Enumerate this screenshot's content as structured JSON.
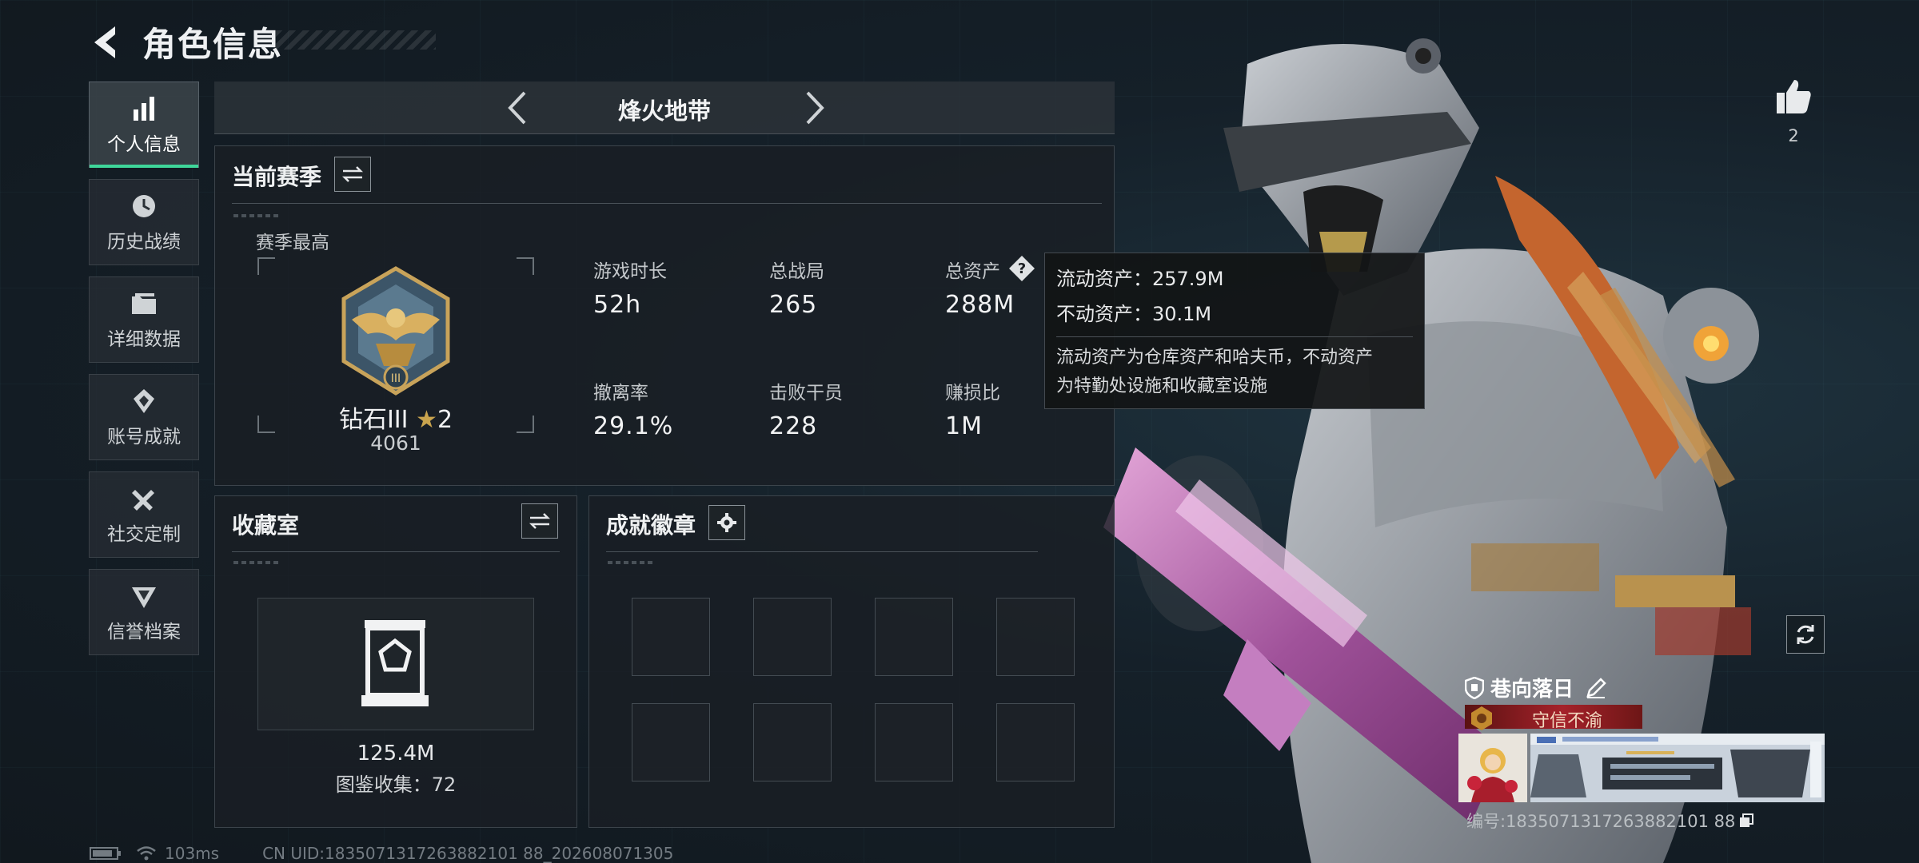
{
  "header": {
    "title": "角色信息"
  },
  "nav": {
    "items": [
      {
        "label": "个人信息",
        "icon": "bar-chart-icon",
        "active": true
      },
      {
        "label": "历史战绩",
        "icon": "clock-history-icon"
      },
      {
        "label": "详细数据",
        "icon": "folder-icon"
      },
      {
        "label": "账号成就",
        "icon": "achievement-badge-icon"
      },
      {
        "label": "社交定制",
        "icon": "tools-icon"
      },
      {
        "label": "信誉档案",
        "icon": "reputation-icon"
      }
    ]
  },
  "mode": {
    "title": "烽火地带"
  },
  "season": {
    "title": "当前赛季",
    "best_label": "赛季最高",
    "rank_name": "钻石III",
    "rank_stars": "2",
    "rank_score": "4061",
    "stats": [
      {
        "label": "游戏时长",
        "value": "52h"
      },
      {
        "label": "总战局",
        "value": "265"
      },
      {
        "label": "总资产",
        "value": "288M"
      },
      {
        "label": "撤离率",
        "value": "29.1%"
      },
      {
        "label": "击败干员",
        "value": "228"
      },
      {
        "label": "赚损比",
        "value": "1M"
      }
    ]
  },
  "tooltip": {
    "liquid": "流动资产：257.9M",
    "fixed": "不动资产：30.1M",
    "desc_line1": "流动资产为仓库资产和哈夫币，不动资产",
    "desc_line2": "为特勤处设施和收藏室设施"
  },
  "collection": {
    "title": "收藏室",
    "value": "125.4M",
    "count": "图鉴收集：72"
  },
  "badges": {
    "title": "成就徽章",
    "slot_count": 8
  },
  "status": {
    "ping": "103ms",
    "uid": "CN UID:1835071317263882101 88_202608071305"
  },
  "showcase": {
    "like_count": "2"
  },
  "player_card": {
    "name": "巷向落日",
    "title": "守信不渝",
    "card_id": "编号:1835071317263882101 88"
  },
  "colors": {
    "accent_green": "#3fd69a",
    "title_red": "#a5222a",
    "panel_bg": "#1a1f24"
  }
}
